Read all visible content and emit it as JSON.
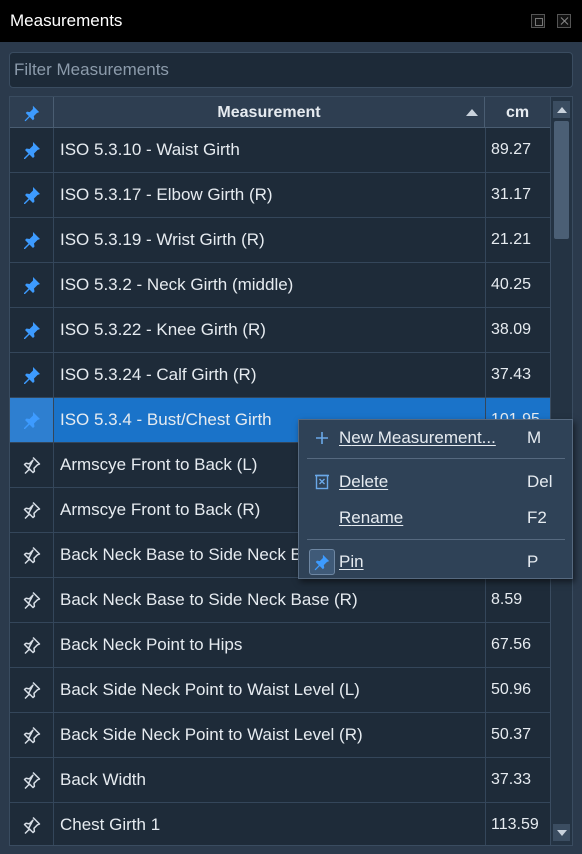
{
  "window": {
    "title": "Measurements"
  },
  "filter": {
    "placeholder": "Filter Measurements",
    "value": ""
  },
  "table": {
    "columns": {
      "pin": "",
      "name": "Measurement",
      "value": "cm"
    },
    "sort": {
      "column": "Measurement",
      "direction": "ascending"
    },
    "rows": [
      {
        "name": "ISO 5.3.10 - Waist Girth",
        "value": "89.27",
        "pinned": true,
        "selected": false
      },
      {
        "name": "ISO 5.3.17 - Elbow Girth (R)",
        "value": "31.17",
        "pinned": true,
        "selected": false
      },
      {
        "name": "ISO 5.3.19 - Wrist Girth (R)",
        "value": "21.21",
        "pinned": true,
        "selected": false
      },
      {
        "name": "ISO 5.3.2 - Neck Girth (middle)",
        "value": "40.25",
        "pinned": true,
        "selected": false
      },
      {
        "name": "ISO 5.3.22 - Knee Girth (R)",
        "value": "38.09",
        "pinned": true,
        "selected": false
      },
      {
        "name": "ISO 5.3.24 - Calf Girth (R)",
        "value": "37.43",
        "pinned": true,
        "selected": false
      },
      {
        "name": "ISO 5.3.4 - Bust/Chest Girth",
        "value": "101.95",
        "pinned": true,
        "selected": true
      },
      {
        "name": "Armscye Front to Back (L)",
        "value": "",
        "pinned": false,
        "selected": false
      },
      {
        "name": "Armscye Front to Back (R)",
        "value": "",
        "pinned": false,
        "selected": false
      },
      {
        "name": "Back Neck Base to Side Neck Base (L)",
        "value": "",
        "pinned": false,
        "selected": false
      },
      {
        "name": "Back Neck Base to Side Neck Base (R)",
        "value": "8.59",
        "pinned": false,
        "selected": false
      },
      {
        "name": "Back Neck Point to Hips",
        "value": "67.56",
        "pinned": false,
        "selected": false
      },
      {
        "name": "Back Side Neck Point to Waist Level (L)",
        "value": "50.96",
        "pinned": false,
        "selected": false
      },
      {
        "name": "Back Side Neck Point to Waist Level (R)",
        "value": "50.37",
        "pinned": false,
        "selected": false
      },
      {
        "name": "Back Width",
        "value": "37.33",
        "pinned": false,
        "selected": false
      },
      {
        "name": "Chest Girth 1",
        "value": "113.59",
        "pinned": false,
        "selected": false
      }
    ]
  },
  "context_menu": {
    "items": [
      {
        "id": "new",
        "mnemonic": "N",
        "rest": "ew Measurement...",
        "shortcut": "M",
        "icon": "plus-icon"
      },
      {
        "id": "delete",
        "mnemonic": "D",
        "rest": "elete",
        "shortcut": "Del",
        "icon": "trash-icon"
      },
      {
        "id": "rename",
        "mnemonic": "R",
        "rest": "ename",
        "shortcut": "F2",
        "icon": ""
      },
      {
        "id": "pin",
        "mnemonic": "P",
        "rest": "in",
        "shortcut": "P",
        "icon": "pin-icon"
      }
    ]
  },
  "colors": {
    "accent": "#1a73c9",
    "pin_filled": "#3d9bff",
    "pin_outline": "#d6dde5",
    "background": "#1e2b39"
  }
}
